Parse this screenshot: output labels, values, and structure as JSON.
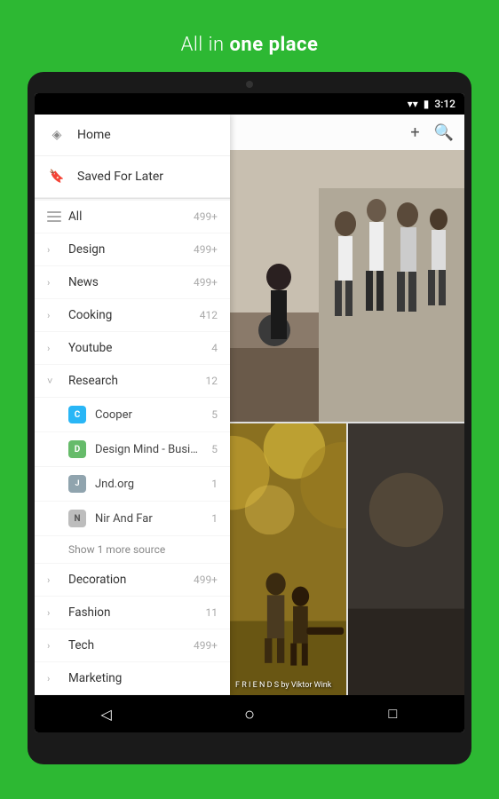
{
  "header": {
    "title_plain": "All in ",
    "title_bold": "one place"
  },
  "statusBar": {
    "time": "3:12"
  },
  "sidebar": {
    "navItems": [
      {
        "id": "home",
        "label": "Home",
        "icon": "tag"
      },
      {
        "id": "saved",
        "label": "Saved For Later",
        "icon": "bookmark"
      }
    ],
    "categories": [
      {
        "id": "all",
        "label": "All",
        "count": "499+",
        "type": "all"
      },
      {
        "id": "design",
        "label": "Design",
        "count": "499+",
        "type": "collapsed"
      },
      {
        "id": "news",
        "label": "News",
        "count": "499+",
        "type": "collapsed"
      },
      {
        "id": "cooking",
        "label": "Cooking",
        "count": "412",
        "type": "collapsed"
      },
      {
        "id": "youtube",
        "label": "Youtube",
        "count": "4",
        "type": "collapsed"
      },
      {
        "id": "research",
        "label": "Research",
        "count": "12",
        "type": "expanded"
      }
    ],
    "researchSubs": [
      {
        "id": "cooper",
        "label": "Cooper",
        "count": "5",
        "color": "#29b6f6",
        "initials": "C"
      },
      {
        "id": "designmind",
        "label": "Design Mind - Business. Tec",
        "count": "5",
        "color": "#66bb6a",
        "initials": "D"
      },
      {
        "id": "jnd",
        "label": "Jnd.org",
        "count": "1",
        "color": "#90a4ae",
        "initials": "J"
      },
      {
        "id": "nir",
        "label": "Nir And Far",
        "count": "1",
        "color": "#bdbdbd",
        "initials": "N"
      }
    ],
    "showMore": "Show 1 more source",
    "afterResearch": [
      {
        "id": "decoration",
        "label": "Decoration",
        "count": "499+",
        "type": "collapsed"
      },
      {
        "id": "fashion",
        "label": "Fashion",
        "count": "11",
        "type": "collapsed"
      },
      {
        "id": "tech",
        "label": "Tech",
        "count": "499+",
        "type": "collapsed"
      },
      {
        "id": "marketing",
        "label": "Marketing",
        "count": "",
        "type": "collapsed"
      }
    ]
  },
  "toolbar": {
    "addLabel": "+",
    "searchLabel": "🔍"
  },
  "photoCaption": "F R I E N D S by Viktor Wink",
  "bottomNav": {
    "back": "◁",
    "home": "○",
    "recents": "□"
  }
}
